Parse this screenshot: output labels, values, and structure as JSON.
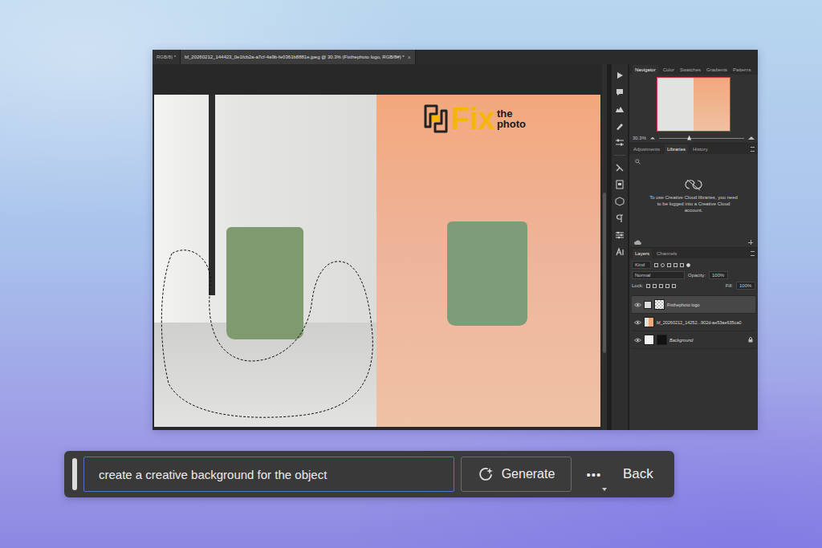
{
  "document_tabs": [
    {
      "label": "RGB/8) *",
      "selected": false
    },
    {
      "label": "bf_20260212_144423_0e1fcb2a-a7cf-4a9b-fe0361b8881e.jpeg @ 30.3% (Fixthephoto logo, RGB/8#) *",
      "selected": true
    }
  ],
  "tab_close": "×",
  "canvas": {
    "logo": {
      "word": "Fix",
      "top": "the",
      "bottom": "photo"
    },
    "selection_active": true
  },
  "navigator": {
    "tabs": [
      {
        "label": "Navigator",
        "selected": true
      },
      {
        "label": "Color",
        "selected": false
      },
      {
        "label": "Swatches",
        "selected": false
      },
      {
        "label": "Gradients",
        "selected": false
      },
      {
        "label": "Patterns",
        "selected": false
      }
    ],
    "zoom": "30.3%",
    "zoom_level": 0.35
  },
  "libraries": {
    "tabs": [
      {
        "label": "Adjustments",
        "selected": false
      },
      {
        "label": "Libraries",
        "selected": true
      },
      {
        "label": "History",
        "selected": false
      }
    ],
    "message": "To use Creative Cloud libraries, you need to be logged into a Creative Cloud account."
  },
  "layers": {
    "tabs": [
      {
        "label": "Layers",
        "selected": true
      },
      {
        "label": "Channels",
        "selected": false
      }
    ],
    "filter": "Kind",
    "blend_mode": "Normal",
    "opacity_label": "Opacity:",
    "opacity": "100%",
    "lock_label": "Lock:",
    "fill_label": "Fill:",
    "fill": "100%",
    "items": [
      {
        "name": "Fixthephoto logo",
        "kind": "logo",
        "selected": true,
        "visible": true,
        "locked": false,
        "italic": false
      },
      {
        "name": "bf_20260212_14252...902d-ae53ae635ca0",
        "kind": "photo",
        "selected": false,
        "visible": true,
        "locked": false,
        "italic": false
      },
      {
        "name": "Background",
        "kind": "background",
        "selected": false,
        "visible": true,
        "locked": true,
        "italic": true
      }
    ]
  },
  "generate_bar": {
    "prompt": "create a creative background for the object",
    "button": "Generate",
    "more": "•••",
    "back": "Back"
  }
}
